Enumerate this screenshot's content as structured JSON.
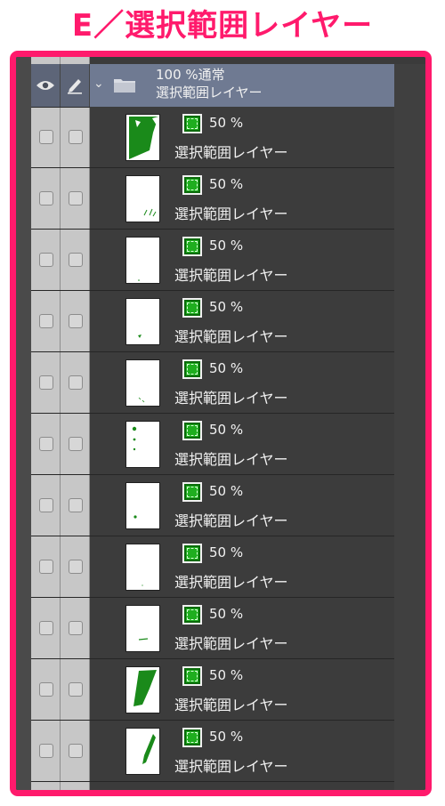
{
  "heading": "E／選択範囲レイヤー",
  "group": {
    "opacity_mode": "100 %通常",
    "name": "選択範囲レイヤー",
    "icons": [
      "eye-icon",
      "pen-icon",
      "chevron-down-icon",
      "folder-icon"
    ]
  },
  "layers": [
    {
      "opacity": "50 %",
      "name": "選択範囲レイヤー"
    },
    {
      "opacity": "50 %",
      "name": "選択範囲レイヤー"
    },
    {
      "opacity": "50 %",
      "name": "選択範囲レイヤー"
    },
    {
      "opacity": "50 %",
      "name": "選択範囲レイヤー"
    },
    {
      "opacity": "50 %",
      "name": "選択範囲レイヤー"
    },
    {
      "opacity": "50 %",
      "name": "選択範囲レイヤー"
    },
    {
      "opacity": "50 %",
      "name": "選択範囲レイヤー"
    },
    {
      "opacity": "50 %",
      "name": "選択範囲レイヤー"
    },
    {
      "opacity": "50 %",
      "name": "選択範囲レイヤー"
    },
    {
      "opacity": "50 %",
      "name": "選択範囲レイヤー"
    },
    {
      "opacity": "50 %",
      "name": "選択範囲レイヤー"
    }
  ],
  "colors": {
    "accent": "#ff1a6c",
    "selection_green": "#1fae1f",
    "panel_bg": "#3b3b3b",
    "header_bg": "#6f7a92"
  }
}
